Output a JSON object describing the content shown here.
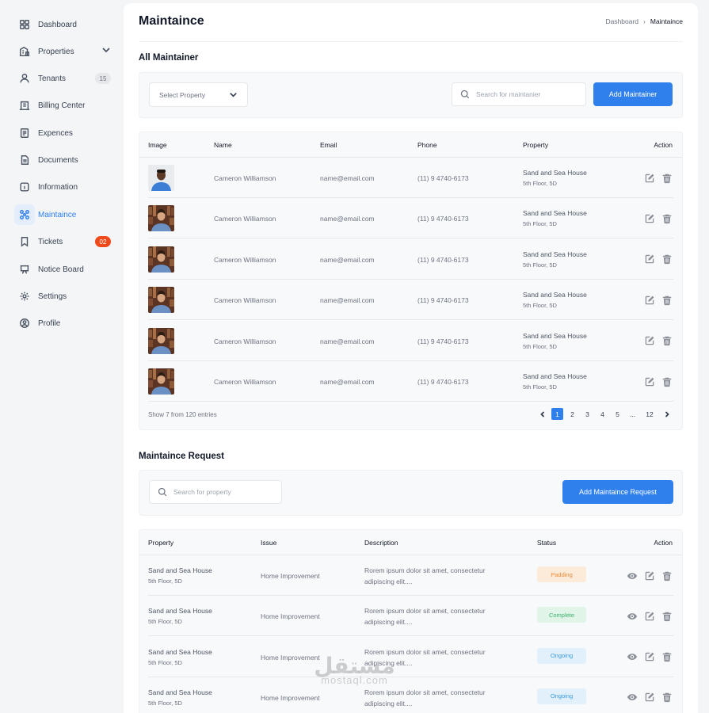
{
  "sidebar": {
    "items": [
      {
        "label": "Dashboard",
        "icon": "grid-icon"
      },
      {
        "label": "Properties",
        "icon": "building-icon"
      },
      {
        "label": "Tenants",
        "icon": "user-icon",
        "badge": "15"
      },
      {
        "label": "Billing Center",
        "icon": "billing-icon"
      },
      {
        "label": "Expences",
        "icon": "receipt-icon"
      },
      {
        "label": "Documents",
        "icon": "document-icon"
      },
      {
        "label": "Information",
        "icon": "info-icon"
      },
      {
        "label": "Maintaince",
        "icon": "maintenance-icon"
      },
      {
        "label": "Tickets",
        "icon": "ticket-icon",
        "badge": "02"
      },
      {
        "label": "Notice Board",
        "icon": "notice-board-icon"
      },
      {
        "label": "Settings",
        "icon": "gear-icon"
      },
      {
        "label": "Profile",
        "icon": "profile-icon"
      }
    ]
  },
  "header": {
    "title": "Maintaince",
    "breadcrumb": {
      "parent": "Dashboard",
      "current": "Maintaince"
    }
  },
  "maintainers": {
    "title": "All Maintainer",
    "select_placeholder": "Select Property",
    "search_placeholder": "Search for maintanier",
    "add_button": "Add Maintainer",
    "columns": [
      "Image",
      "Name",
      "Email",
      "Phone",
      "Property",
      "Action"
    ],
    "rows": [
      {
        "name": "Cameron Williamson",
        "email": "name@email.com",
        "phone": "(11) 9 4740-6173",
        "property": "Sand and Sea House",
        "address": "5th Floor, 5D"
      },
      {
        "name": "Cameron Williamson",
        "email": "name@email.com",
        "phone": "(11) 9 4740-6173",
        "property": "Sand and Sea House",
        "address": "5th Floor, 5D"
      },
      {
        "name": "Cameron Williamson",
        "email": "name@email.com",
        "phone": "(11) 9 4740-6173",
        "property": "Sand and Sea House",
        "address": "5th Floor, 5D"
      },
      {
        "name": "Cameron Williamson",
        "email": "name@email.com",
        "phone": "(11) 9 4740-6173",
        "property": "Sand and Sea House",
        "address": "5th Floor, 5D"
      },
      {
        "name": "Cameron Williamson",
        "email": "name@email.com",
        "phone": "(11) 9 4740-6173",
        "property": "Sand and Sea House",
        "address": "5th Floor, 5D"
      },
      {
        "name": "Cameron Williamson",
        "email": "name@email.com",
        "phone": "(11) 9 4740-6173",
        "property": "Sand and Sea House",
        "address": "5th Floor, 5D"
      }
    ],
    "footer_text": "Show 7 from 120 entries",
    "pagination": [
      "1",
      "2",
      "3",
      "4",
      "5",
      "...",
      "12"
    ],
    "current_page": "1"
  },
  "requests": {
    "title": "Maintaince Request",
    "search_placeholder": "Search for property",
    "add_button": "Add Maintaince Request",
    "columns": [
      "Property",
      "Issue",
      "Description",
      "Status",
      "Action"
    ],
    "rows": [
      {
        "property": "Sand and Sea House",
        "address": "5th Floor, 5D",
        "issue": "Home Improvement",
        "desc1": "Rorem ipsum dolor sit amet, consectetur",
        "desc2": "adipiscing elit....",
        "status": "Padding",
        "status_type": "pending"
      },
      {
        "property": "Sand and Sea House",
        "address": "5th Floor, 5D",
        "issue": "Home Improvement",
        "desc1": "Rorem ipsum dolor sit amet, consectetur",
        "desc2": "adipiscing elit....",
        "status": "Complete",
        "status_type": "complete"
      },
      {
        "property": "Sand and Sea House",
        "address": "5th Floor, 5D",
        "issue": "Home Improvement",
        "desc1": "Rorem ipsum dolor sit amet, consectetur",
        "desc2": "adipiscing elit....",
        "status": "Ongoing",
        "status_type": "ongoing"
      },
      {
        "property": "Sand and Sea House",
        "address": "5th Floor, 5D",
        "issue": "Home Improvement",
        "desc1": "Rorem ipsum dolor sit amet, consectetur",
        "desc2": "adipiscing elit....",
        "status": "Ongoing",
        "status_type": "ongoing"
      }
    ]
  },
  "watermark": {
    "arabic": "مستقل",
    "latin": "mostaql.com"
  },
  "colors": {
    "accent": "#2f80ed",
    "badge_red": "#f04a1b",
    "pending": "#e98b3c",
    "complete": "#3bb26c",
    "ongoing": "#3a9bdc"
  }
}
